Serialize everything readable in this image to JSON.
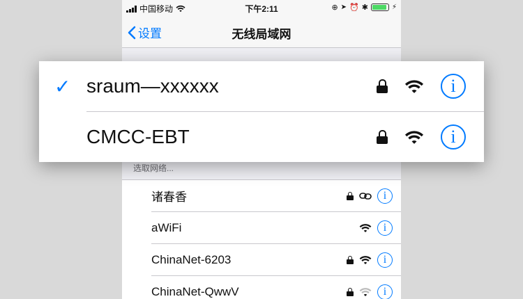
{
  "status_bar": {
    "carrier": "中国移动",
    "time": "下午2:11",
    "battery_level": 0.9,
    "battery_color": "#4cd964"
  },
  "nav": {
    "back_label": "设置",
    "title": "无线局域网"
  },
  "connected_networks": [
    {
      "name": "sraum—xxxxxx",
      "selected": true,
      "locked": true,
      "signal": "full"
    },
    {
      "name": "CMCC-EBT",
      "selected": false,
      "locked": true,
      "signal": "full"
    }
  ],
  "choose_network_header": "选取网络...",
  "networks": [
    {
      "name": "诸春香",
      "locked": true,
      "icon": "personal-hotspot-icon"
    },
    {
      "name": "aWiFi",
      "locked": false,
      "icon": "wifi-icon",
      "signal": "full"
    },
    {
      "name": "ChinaNet-6203",
      "locked": true,
      "icon": "wifi-icon",
      "signal": "full"
    },
    {
      "name": "ChinaNet-QwwV",
      "locked": true,
      "icon": "wifi-icon",
      "signal": "weak"
    }
  ],
  "colors": {
    "accent": "#007aff"
  },
  "info_glyph": "i",
  "check_glyph": "✓"
}
